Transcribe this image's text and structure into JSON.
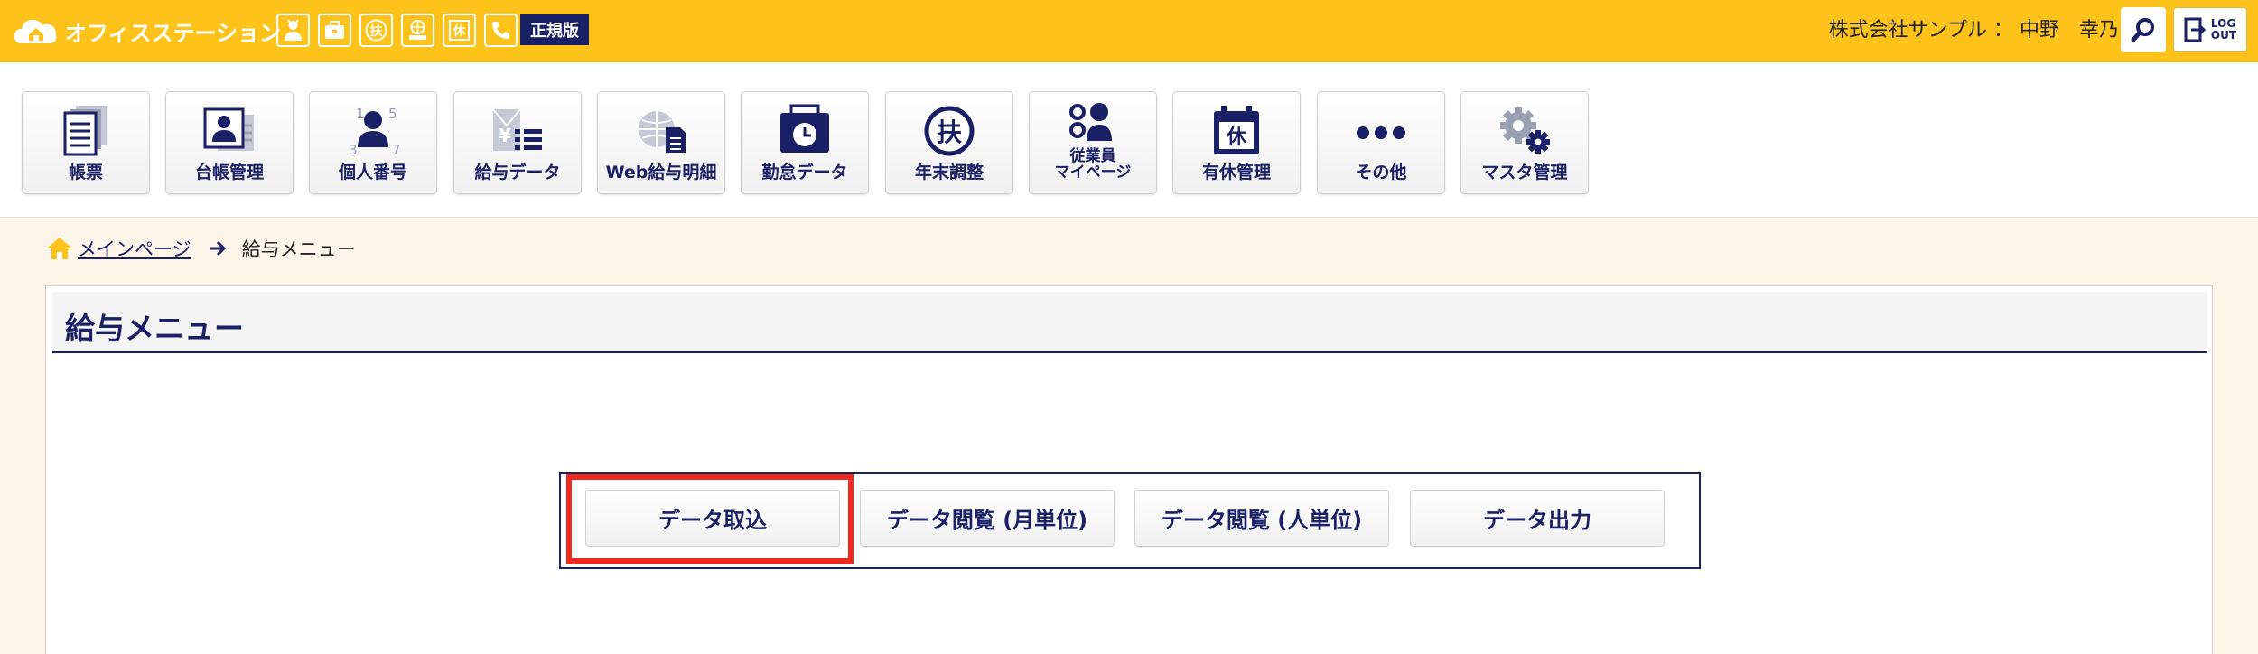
{
  "header": {
    "brand": "オフィスステーション",
    "edition_badge": "正規版",
    "quick_icons": [
      "person-icon",
      "briefcase-icon",
      "fu-icon",
      "web-icon",
      "kyu-icon",
      "phone-icon"
    ],
    "fu_char": "扶",
    "kyu_char": "休",
    "user_text": "株式会社サンプル ： 中野　幸乃",
    "logout_line1": "LOG",
    "logout_line2": "OUT"
  },
  "nav": {
    "items": [
      {
        "label": "帳票",
        "icon": "document-stack-icon"
      },
      {
        "label": "台帳管理",
        "icon": "ledger-card-icon"
      },
      {
        "label": "個人番号",
        "icon": "person-number-icon"
      },
      {
        "label": "給与データ",
        "icon": "salary-yen-icon"
      },
      {
        "label": "Web給与明細",
        "icon": "web-payslip-icon"
      },
      {
        "label": "勤怠データ",
        "icon": "attendance-clock-icon"
      },
      {
        "label": "年末調整",
        "icon": "year-end-fu-icon"
      },
      {
        "label_line1": "従業員",
        "label_line2": "マイページ",
        "icon": "employee-mypage-icon"
      },
      {
        "label": "有休管理",
        "icon": "paid-leave-calendar-icon"
      },
      {
        "label": "その他",
        "icon": "more-dots-icon"
      },
      {
        "label": "マスタ管理",
        "icon": "master-gears-icon"
      }
    ],
    "num_1": "1",
    "num_5": "5",
    "num_3": "3",
    "num_7": "7",
    "yen": "¥",
    "fu": "扶",
    "kyu": "休"
  },
  "breadcrumb": {
    "home": "メインページ",
    "current": "給与メニュー"
  },
  "page": {
    "title": "給与メニュー",
    "buttons": [
      "データ取込",
      "データ閲覧 (月単位)",
      "データ閲覧 (人単位)",
      "データ出力"
    ]
  },
  "colors": {
    "header_bg": "#fdc31a",
    "navy": "#1a2066",
    "content_bg": "#fef5ea",
    "highlight": "#ee2a1e"
  }
}
